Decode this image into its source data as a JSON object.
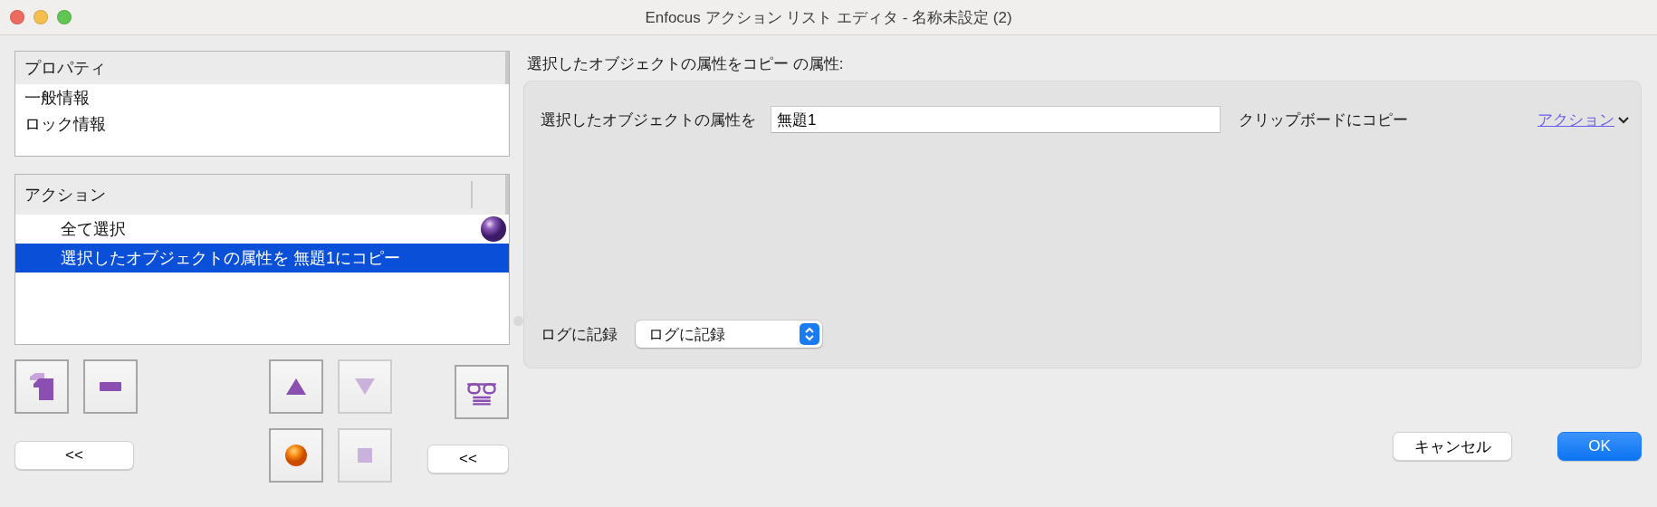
{
  "window": {
    "title": "Enfocus アクション リスト エディタ - 名称未設定 (2)"
  },
  "properties": {
    "header": "プロパティ",
    "items": [
      {
        "label": "一般情報",
        "selected": false
      },
      {
        "label": "ロック情報",
        "selected": false
      }
    ]
  },
  "actions": {
    "header": "アクション",
    "items": [
      {
        "label": "全て選択",
        "selected": false,
        "current": true
      },
      {
        "label": "選択したオブジェクトの属性を 無題1にコピー",
        "selected": true,
        "current": false
      }
    ]
  },
  "list_tools": [
    {
      "kind": "duplicate",
      "disabled": false
    },
    {
      "kind": "remove",
      "disabled": false
    }
  ],
  "move_tools": [
    {
      "kind": "up",
      "disabled": false
    },
    {
      "kind": "down",
      "disabled": true
    }
  ],
  "run_tools": [
    {
      "kind": "run",
      "disabled": false
    },
    {
      "kind": "stop",
      "disabled": true
    }
  ],
  "inspect_tool": {
    "kind": "inspect",
    "disabled": false
  },
  "collapse_left": "<<",
  "collapse_right": "<<",
  "editor": {
    "heading": "選択したオブジェクトの属性をコピー の属性:",
    "prefix_label": "選択したオブジェクトの属性を",
    "value": "無題1",
    "suffix_label": "クリップボードにコピー",
    "menu_link": "アクション",
    "log_label": "ログに記録",
    "log_value": "ログに記録"
  },
  "buttons": [
    {
      "label": "キャンセル",
      "default": false
    },
    {
      "label": "OK",
      "default": true
    }
  ]
}
